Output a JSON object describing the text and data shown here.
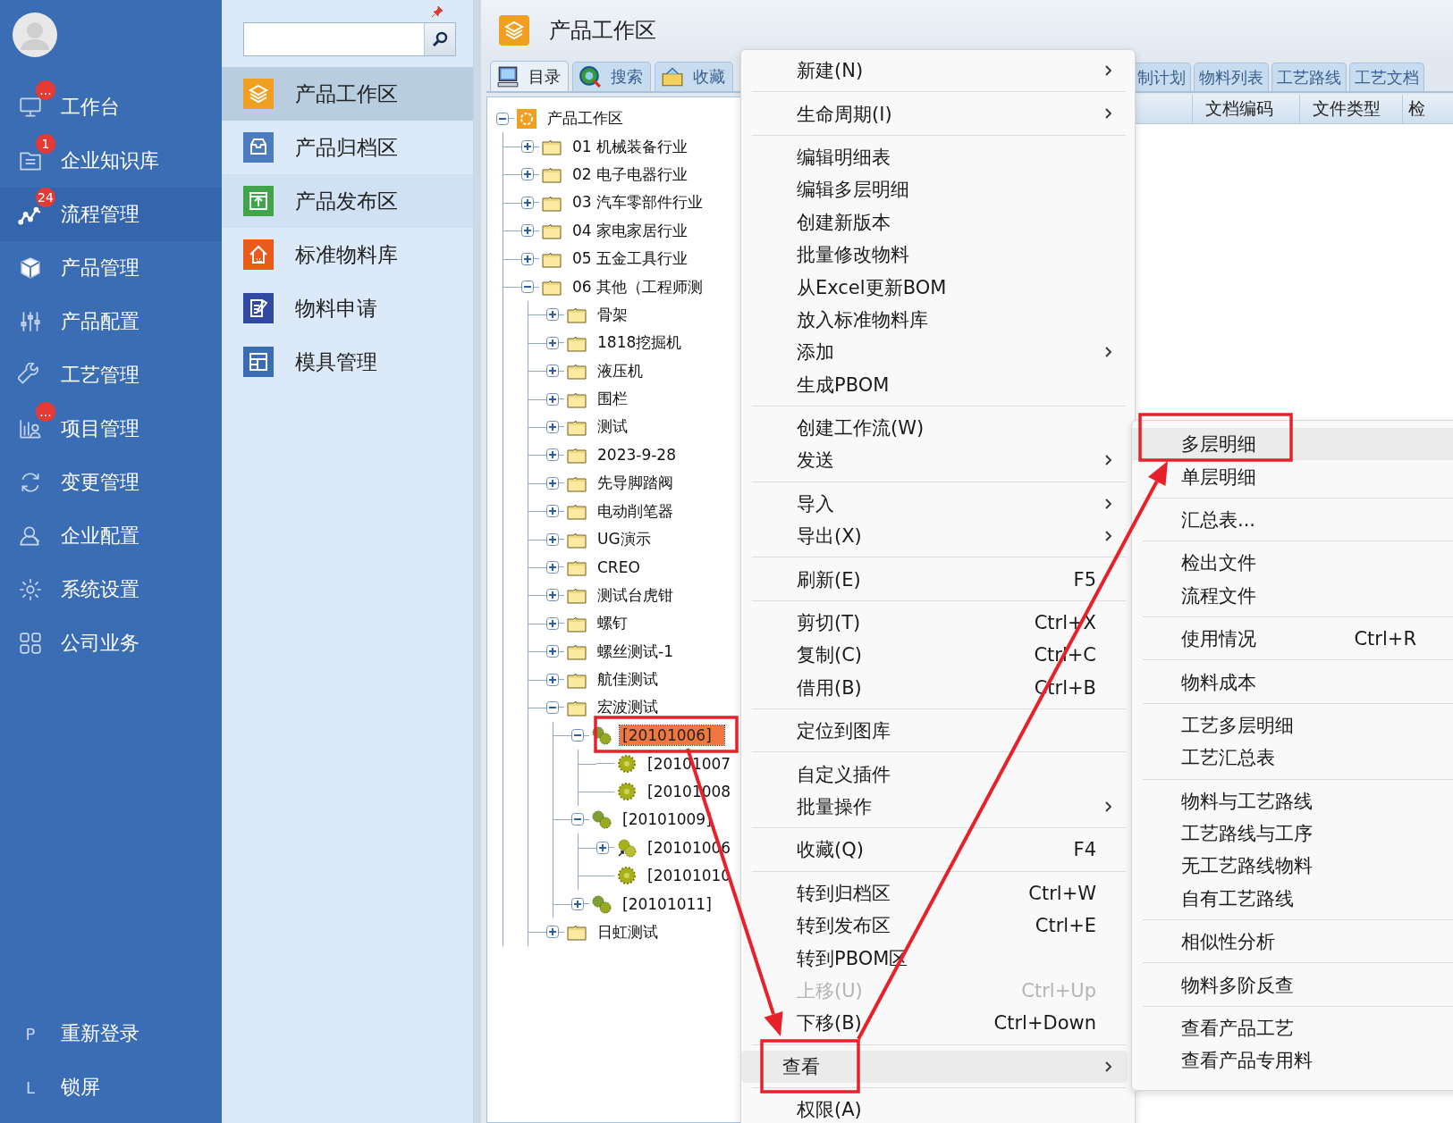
{
  "sidebar": {
    "items": [
      {
        "label": "工作台",
        "badge": "...",
        "selected": false
      },
      {
        "label": "企业知识库",
        "badge": "1",
        "selected": false
      },
      {
        "label": "流程管理",
        "badge": "24",
        "selected": true
      },
      {
        "label": "产品管理",
        "selected": false
      },
      {
        "label": "产品配置",
        "selected": false
      },
      {
        "label": "工艺管理",
        "selected": false
      },
      {
        "label": "项目管理",
        "badge": "...",
        "selected": false
      },
      {
        "label": "变更管理",
        "selected": false
      },
      {
        "label": "企业配置",
        "selected": false
      },
      {
        "label": "系统设置",
        "selected": false
      },
      {
        "label": "公司业务",
        "selected": false
      }
    ],
    "footer_items": [
      {
        "key": "P",
        "label": "重新登录"
      },
      {
        "key": "L",
        "label": "锁屏"
      }
    ]
  },
  "nav_panel": {
    "items": [
      {
        "label": "产品工作区",
        "color": "#f0a020",
        "selected": true,
        "hovered": false
      },
      {
        "label": "产品归档区",
        "color": "#4d7bbf",
        "selected": false,
        "hovered": false
      },
      {
        "label": "产品发布区",
        "color": "#3fa548",
        "selected": false,
        "hovered": true
      },
      {
        "label": "标准物料库",
        "color": "#ea5a1a",
        "selected": false,
        "hovered": false
      },
      {
        "label": "物料申请",
        "color": "#2f4aa0",
        "selected": false,
        "hovered": false
      },
      {
        "label": "模具管理",
        "color": "#3a6db4",
        "selected": false,
        "hovered": false
      }
    ]
  },
  "workspace": {
    "title": "产品工作区",
    "tree_tabs": [
      {
        "label": "目录",
        "selected": true
      },
      {
        "label": "搜索",
        "selected": false
      },
      {
        "label": "收藏",
        "selected": false
      }
    ],
    "tree": {
      "label": "产品工作区",
      "kind": "root",
      "expanded": true,
      "selected": false,
      "children": [
        {
          "label": "01 机械装备行业",
          "kind": "folder",
          "expanded": false,
          "selected": false
        },
        {
          "label": "02 电子电器行业",
          "kind": "folder",
          "expanded": false,
          "selected": false
        },
        {
          "label": "03 汽车零部件行业",
          "kind": "folder",
          "expanded": false,
          "selected": false
        },
        {
          "label": "04 家电家居行业",
          "kind": "folder",
          "expanded": false,
          "selected": false
        },
        {
          "label": "05 五金工具行业",
          "kind": "folder",
          "expanded": false,
          "selected": false
        },
        {
          "label": "06 其他（工程师测",
          "kind": "folder",
          "expanded": true,
          "selected": false,
          "children": [
            {
              "label": "骨架",
              "kind": "folder",
              "expanded": false,
              "selected": false
            },
            {
              "label": "1818挖掘机",
              "kind": "folder",
              "expanded": false,
              "selected": false
            },
            {
              "label": "液压机",
              "kind": "folder",
              "expanded": false,
              "selected": false
            },
            {
              "label": "围栏",
              "kind": "folder",
              "expanded": false,
              "selected": false
            },
            {
              "label": "测试",
              "kind": "folder",
              "expanded": false,
              "selected": false
            },
            {
              "label": "2023-9-28",
              "kind": "folder",
              "expanded": false,
              "selected": false
            },
            {
              "label": "先导脚踏阀",
              "kind": "folder",
              "expanded": false,
              "selected": false
            },
            {
              "label": "电动削笔器",
              "kind": "folder",
              "expanded": false,
              "selected": false
            },
            {
              "label": "UG演示",
              "kind": "folder",
              "expanded": false,
              "selected": false
            },
            {
              "label": "CREO",
              "kind": "folder",
              "expanded": false,
              "selected": false
            },
            {
              "label": "测试台虎钳",
              "kind": "folder",
              "expanded": false,
              "selected": false
            },
            {
              "label": "螺钉",
              "kind": "folder",
              "expanded": false,
              "selected": false
            },
            {
              "label": "螺丝测试-1",
              "kind": "folder",
              "expanded": false,
              "selected": false
            },
            {
              "label": "航佳测试",
              "kind": "folder",
              "expanded": false,
              "selected": false
            },
            {
              "label": "宏波测试",
              "kind": "folder",
              "expanded": true,
              "selected": false,
              "children": [
                {
                  "label": "[20101006]",
                  "kind": "assembly",
                  "expanded": true,
                  "selected": true,
                  "children": [
                    {
                      "label": "[20101007",
                      "kind": "part",
                      "selected": false
                    },
                    {
                      "label": "[20101008",
                      "kind": "part",
                      "selected": false
                    }
                  ]
                },
                {
                  "label": "[20101009]",
                  "kind": "assembly",
                  "expanded": true,
                  "selected": false,
                  "children": [
                    {
                      "label": "[20101006",
                      "kind": "linked",
                      "expanded": false,
                      "selected": false
                    },
                    {
                      "label": "[20101010",
                      "kind": "part",
                      "selected": false
                    }
                  ]
                },
                {
                  "label": "[20101011]",
                  "kind": "assembly",
                  "expanded": false,
                  "selected": false
                }
              ]
            },
            {
              "label": "日虹测试",
              "kind": "folder",
              "expanded": false,
              "selected": false
            }
          ]
        }
      ]
    },
    "detail_tabs": [
      {
        "label": "制计划",
        "selected": false
      },
      {
        "label": "物料列表",
        "selected": false
      },
      {
        "label": "工艺路线",
        "selected": false
      },
      {
        "label": "工艺文档",
        "selected": false
      }
    ],
    "columns": [
      "文档编码",
      "文件类型",
      "检"
    ]
  },
  "context_menu": {
    "groups": [
      [
        {
          "label": "新建(N)",
          "has_submenu": true,
          "disabled": false,
          "selected": false
        }
      ],
      [
        {
          "label": "生命周期(I)",
          "has_submenu": true,
          "disabled": false,
          "selected": false
        }
      ],
      [
        {
          "label": "编辑明细表",
          "has_submenu": false,
          "disabled": false,
          "selected": false
        },
        {
          "label": "编辑多层明细",
          "has_submenu": false,
          "disabled": false,
          "selected": false
        },
        {
          "label": "创建新版本",
          "has_submenu": false,
          "disabled": false,
          "selected": false
        },
        {
          "label": "批量修改物料",
          "has_submenu": false,
          "disabled": false,
          "selected": false
        },
        {
          "label": "从Excel更新BOM",
          "has_submenu": false,
          "disabled": false,
          "selected": false
        },
        {
          "label": "放入标准物料库",
          "has_submenu": false,
          "disabled": false,
          "selected": false
        },
        {
          "label": "添加",
          "has_submenu": true,
          "disabled": false,
          "selected": false
        },
        {
          "label": "生成PBOM",
          "has_submenu": false,
          "disabled": false,
          "selected": false
        }
      ],
      [
        {
          "label": "创建工作流(W)",
          "has_submenu": false,
          "disabled": false,
          "selected": false
        },
        {
          "label": "发送",
          "has_submenu": true,
          "disabled": false,
          "selected": false
        }
      ],
      [
        {
          "label": "导入",
          "has_submenu": true,
          "disabled": false,
          "selected": false
        },
        {
          "label": "导出(X)",
          "has_submenu": true,
          "disabled": false,
          "selected": false
        }
      ],
      [
        {
          "label": "刷新(E)",
          "shortcut": "F5",
          "has_submenu": false,
          "disabled": false,
          "selected": false
        }
      ],
      [
        {
          "label": "剪切(T)",
          "shortcut": "Ctrl+X",
          "has_submenu": false,
          "disabled": false,
          "selected": false
        },
        {
          "label": "复制(C)",
          "shortcut": "Ctrl+C",
          "has_submenu": false,
          "disabled": false,
          "selected": false
        },
        {
          "label": "借用(B)",
          "shortcut": "Ctrl+B",
          "has_submenu": false,
          "disabled": false,
          "selected": false
        }
      ],
      [
        {
          "label": "定位到图库",
          "has_submenu": false,
          "disabled": false,
          "selected": false
        }
      ],
      [
        {
          "label": "自定义插件",
          "has_submenu": false,
          "disabled": false,
          "selected": false
        },
        {
          "label": "批量操作",
          "has_submenu": true,
          "disabled": false,
          "selected": false
        }
      ],
      [
        {
          "label": "收藏(Q)",
          "shortcut": "F4",
          "has_submenu": false,
          "disabled": false,
          "selected": false
        }
      ],
      [
        {
          "label": "转到归档区",
          "shortcut": "Ctrl+W",
          "has_submenu": false,
          "disabled": false,
          "selected": false
        },
        {
          "label": "转到发布区",
          "shortcut": "Ctrl+E",
          "has_submenu": false,
          "disabled": false,
          "selected": false
        },
        {
          "label": "转到PBOM区",
          "has_submenu": false,
          "disabled": false,
          "selected": false
        },
        {
          "label": "上移(U)",
          "shortcut": "Ctrl+Up",
          "has_submenu": false,
          "disabled": true,
          "selected": false
        },
        {
          "label": "下移(B)",
          "shortcut": "Ctrl+Down",
          "has_submenu": false,
          "disabled": false,
          "selected": false
        }
      ],
      [
        {
          "label": "查看",
          "has_submenu": true,
          "disabled": false,
          "selected": true
        }
      ],
      [
        {
          "label": "权限(A)",
          "has_submenu": false,
          "disabled": false,
          "selected": false
        }
      ]
    ]
  },
  "submenu": {
    "groups": [
      [
        {
          "label": "多层明细",
          "selected": true
        },
        {
          "label": "单层明细",
          "selected": false
        }
      ],
      [
        {
          "label": "汇总表...",
          "selected": false
        }
      ],
      [
        {
          "label": "检出文件",
          "selected": false
        },
        {
          "label": "流程文件",
          "selected": false
        }
      ],
      [
        {
          "label": "使用情况",
          "shortcut": "Ctrl+R",
          "selected": false
        }
      ],
      [
        {
          "label": "物料成本",
          "selected": false
        }
      ],
      [
        {
          "label": "工艺多层明细",
          "selected": false
        },
        {
          "label": "工艺汇总表",
          "selected": false
        }
      ],
      [
        {
          "label": "物料与工艺路线",
          "selected": false
        },
        {
          "label": "工艺路线与工序",
          "selected": false
        },
        {
          "label": "无工艺路线物料",
          "selected": false
        },
        {
          "label": "自有工艺路线",
          "selected": false
        }
      ],
      [
        {
          "label": "相似性分析",
          "selected": false
        }
      ],
      [
        {
          "label": "物料多阶反查",
          "selected": false
        }
      ],
      [
        {
          "label": "查看产品工艺",
          "selected": false
        },
        {
          "label": "查看产品专用料",
          "selected": false
        }
      ]
    ]
  }
}
